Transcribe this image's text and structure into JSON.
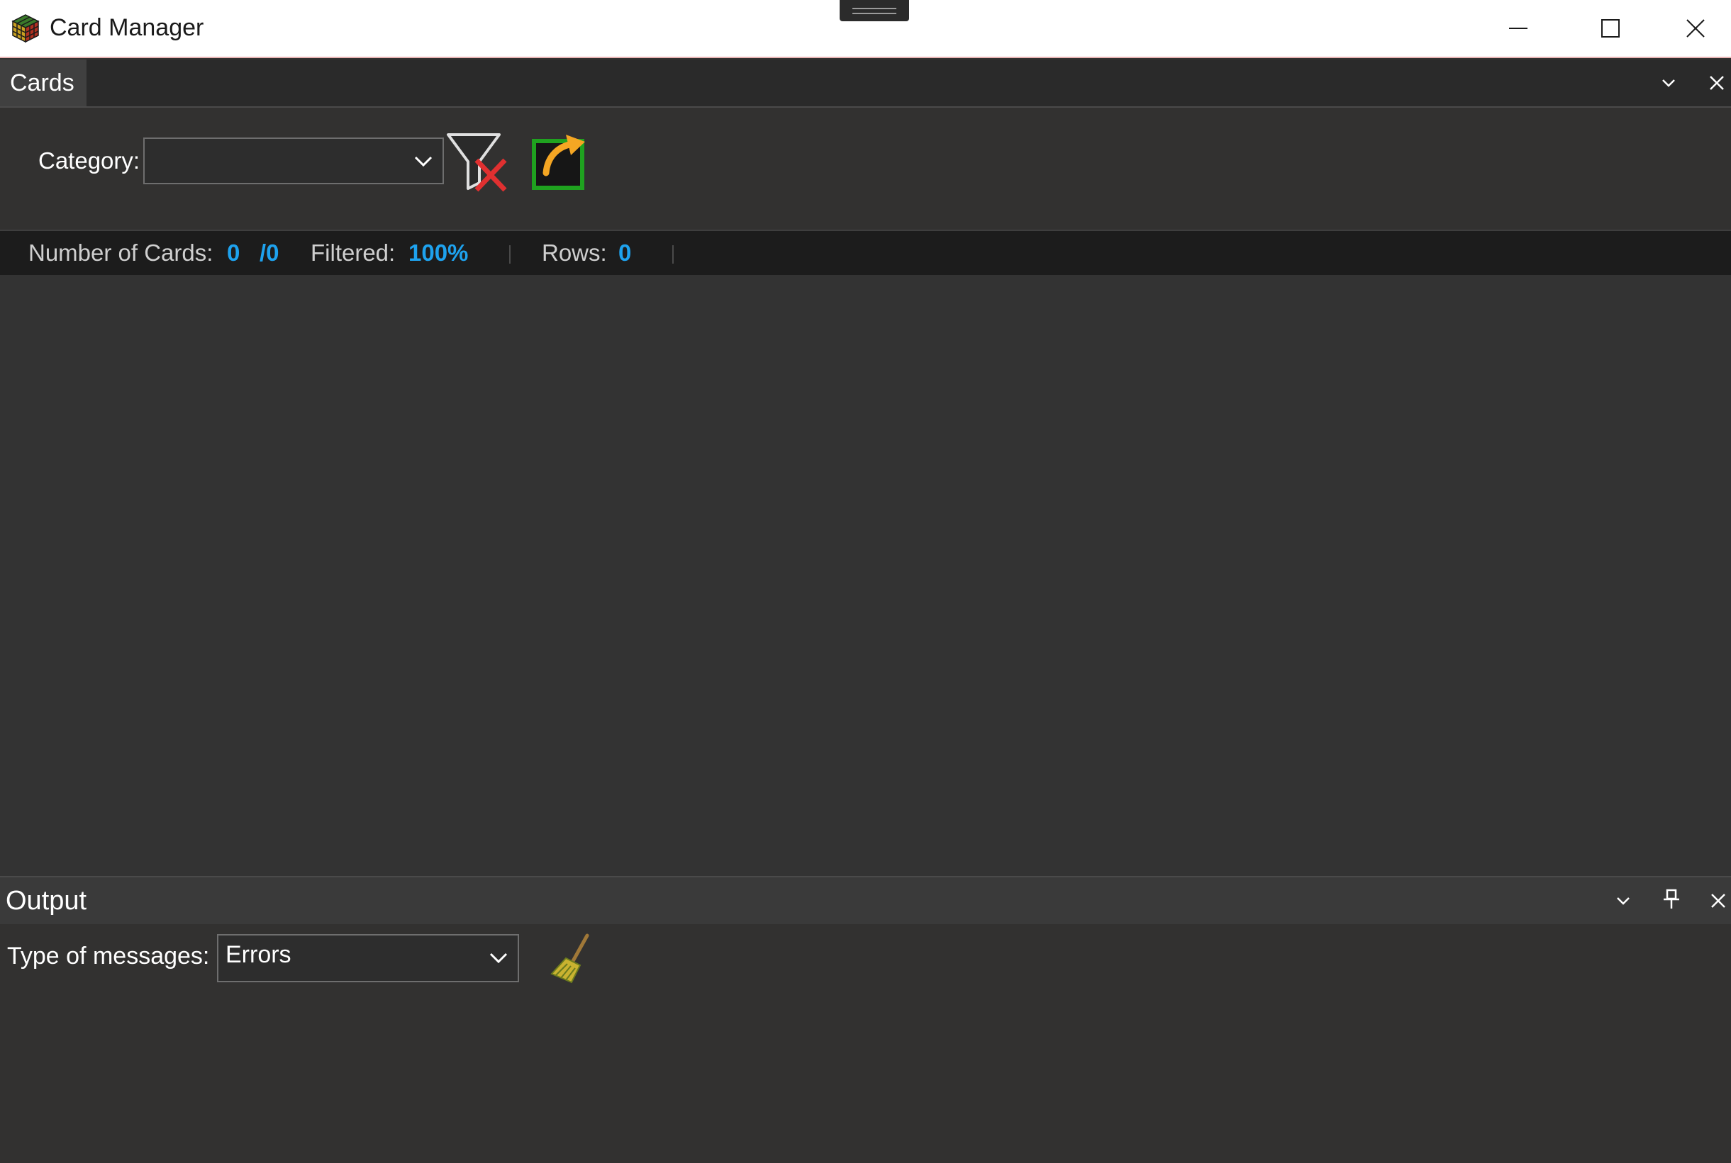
{
  "window": {
    "title": "Card Manager",
    "controls": {
      "minimize_icon": "minimize-icon",
      "maximize_icon": "maximize-icon",
      "close_icon": "close-icon"
    }
  },
  "cards_panel": {
    "tab_label": "Cards",
    "category_label": "Category:",
    "category_value": "",
    "tools": [
      "clear-filter-icon",
      "export-icon"
    ]
  },
  "status": {
    "cards_label": "Number of Cards:",
    "cards_count": "0",
    "cards_total": "/0",
    "filtered_label": "Filtered:",
    "filtered_value": "100%",
    "rows_label": "Rows:",
    "rows_value": "0"
  },
  "output_panel": {
    "title": "Output",
    "type_label": "Type of messages:",
    "type_value": "Errors",
    "clear_icon": "broom-icon"
  },
  "colors": {
    "accent": "#1ea2ee",
    "panel_bg": "#323130",
    "status_bg": "#1c1c1c",
    "filter_x": "#e03030",
    "export_green": "#1fa21f",
    "export_arrow": "#f5a623"
  }
}
